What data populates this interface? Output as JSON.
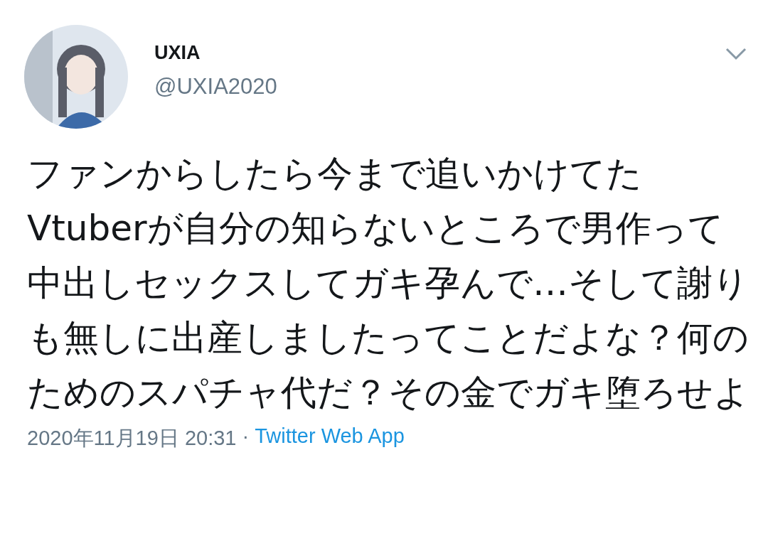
{
  "author": {
    "name": "UXIA",
    "handle": "@UXIA2020"
  },
  "tweet": {
    "text": "ファンからしたら今まで追いかけてたVtuberが自分の知らないところで男作って中出しセックスしてガキ孕んで…そして謝りも無しに出産しましたってことだよな？何のためのスパチャ代だ？その金でガキ堕ろせよ"
  },
  "meta": {
    "timestamp": "2020年11月19日 20:31",
    "separator": "·",
    "source": "Twitter Web App"
  }
}
